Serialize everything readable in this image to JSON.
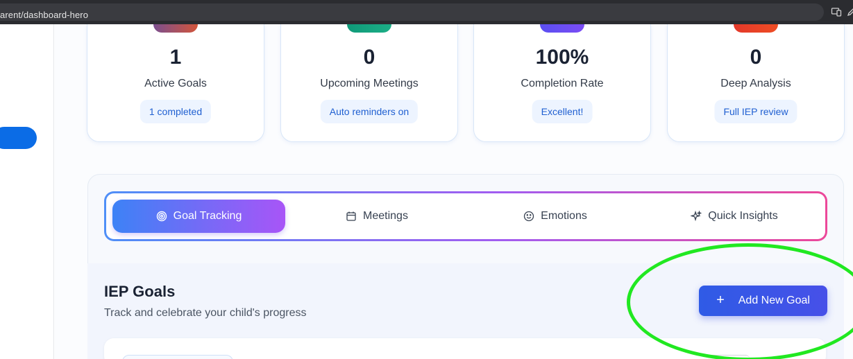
{
  "browser": {
    "url_text": "arent/dashboard-hero",
    "icons": [
      "devices-icon",
      "pen-icon"
    ]
  },
  "sidebar": {
    "active_item": "nav-pill"
  },
  "stats": [
    {
      "value": "1",
      "label": "Active Goals",
      "badge": "1 completed",
      "icon_color": "#c8553d"
    },
    {
      "value": "0",
      "label": "Upcoming Meetings",
      "badge": "Auto reminders on",
      "icon_color": "#14a37f"
    },
    {
      "value": "100%",
      "label": "Completion Rate",
      "badge": "Excellent!",
      "icon_color": "#6d4cf5"
    },
    {
      "value": "0",
      "label": "Deep Analysis",
      "badge": "Full IEP review",
      "icon_color": "#e4412a"
    }
  ],
  "tabs": [
    {
      "label": "Goal Tracking",
      "icon": "target-icon",
      "active": true
    },
    {
      "label": "Meetings",
      "icon": "calendar-icon",
      "active": false
    },
    {
      "label": "Emotions",
      "icon": "smile-icon",
      "active": false
    },
    {
      "label": "Quick Insights",
      "icon": "sparkles-icon",
      "active": false
    }
  ],
  "goals": {
    "title": "IEP Goals",
    "subtitle": "Track and celebrate your child's progress",
    "add_button_label": "Add New Goal",
    "add_button_icon": "plus-icon"
  },
  "annotation": {
    "color": "#21e821",
    "shape": "ellipse-highlight"
  },
  "colors": {
    "accent": "#2f5be6",
    "tab_gradient_start": "#3d82f6",
    "tab_gradient_end": "#a855f7",
    "border_gradient_end": "#ec4899"
  }
}
